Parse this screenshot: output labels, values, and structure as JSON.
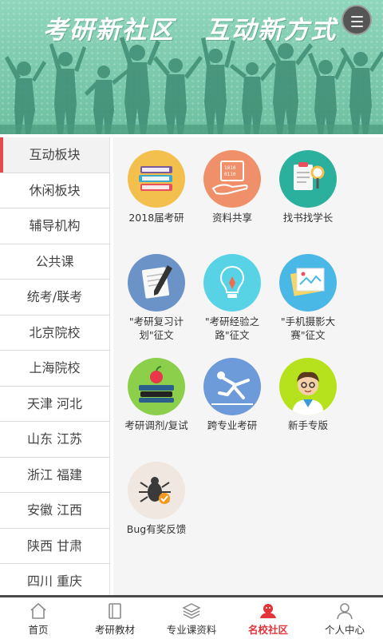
{
  "banner": {
    "title": "考研新社区   互动新方式"
  },
  "sidebar": {
    "items": [
      {
        "label": "互动板块",
        "active": true
      },
      {
        "label": "休闲板块"
      },
      {
        "label": "辅导机构"
      },
      {
        "label": "公共课"
      },
      {
        "label": "统考/联考"
      },
      {
        "label": "北京院校"
      },
      {
        "label": "上海院校"
      },
      {
        "label": "天津 河北"
      },
      {
        "label": "山东 江苏"
      },
      {
        "label": "浙江 福建"
      },
      {
        "label": "安徽 江西"
      },
      {
        "label": "陕西 甘肃"
      },
      {
        "label": "四川 重庆"
      }
    ]
  },
  "tiles": [
    {
      "label": "2018届考研",
      "icon": "books-icon",
      "color": "#f3c04d"
    },
    {
      "label": "资料共享",
      "icon": "share-hand-icon",
      "color": "#f0906a"
    },
    {
      "label": "找书找学长",
      "icon": "clipboard-magnifier-icon",
      "color": "#2bb09e"
    },
    {
      "label": "\"考研复习计划\"征文",
      "icon": "notebook-pen-icon",
      "color": "#6b93c8"
    },
    {
      "label": "\"考研经验之路\"征文",
      "icon": "lightbulb-pen-icon",
      "color": "#58d3e6"
    },
    {
      "label": "\"手机摄影大赛\"征文",
      "icon": "photo-map-icon",
      "color": "#4ab8e6"
    },
    {
      "label": "考研调剂/复试",
      "icon": "apple-books-icon",
      "color": "#8bcf4a"
    },
    {
      "label": "跨专业考研",
      "icon": "hurdle-runner-icon",
      "color": "#6d9ad8"
    },
    {
      "label": "新手专版",
      "icon": "student-avatar-icon",
      "color": "#b5e21d"
    },
    {
      "label": "Bug有奖反馈",
      "icon": "bug-icon",
      "color": "#efe7e0"
    }
  ],
  "bottom_nav": {
    "items": [
      {
        "label": "首页",
        "icon": "home-icon"
      },
      {
        "label": "考研教材",
        "icon": "book-icon"
      },
      {
        "label": "专业课资料",
        "icon": "layers-icon"
      },
      {
        "label": "名校社区",
        "icon": "community-icon",
        "active": true
      },
      {
        "label": "个人中心",
        "icon": "user-icon"
      }
    ]
  }
}
